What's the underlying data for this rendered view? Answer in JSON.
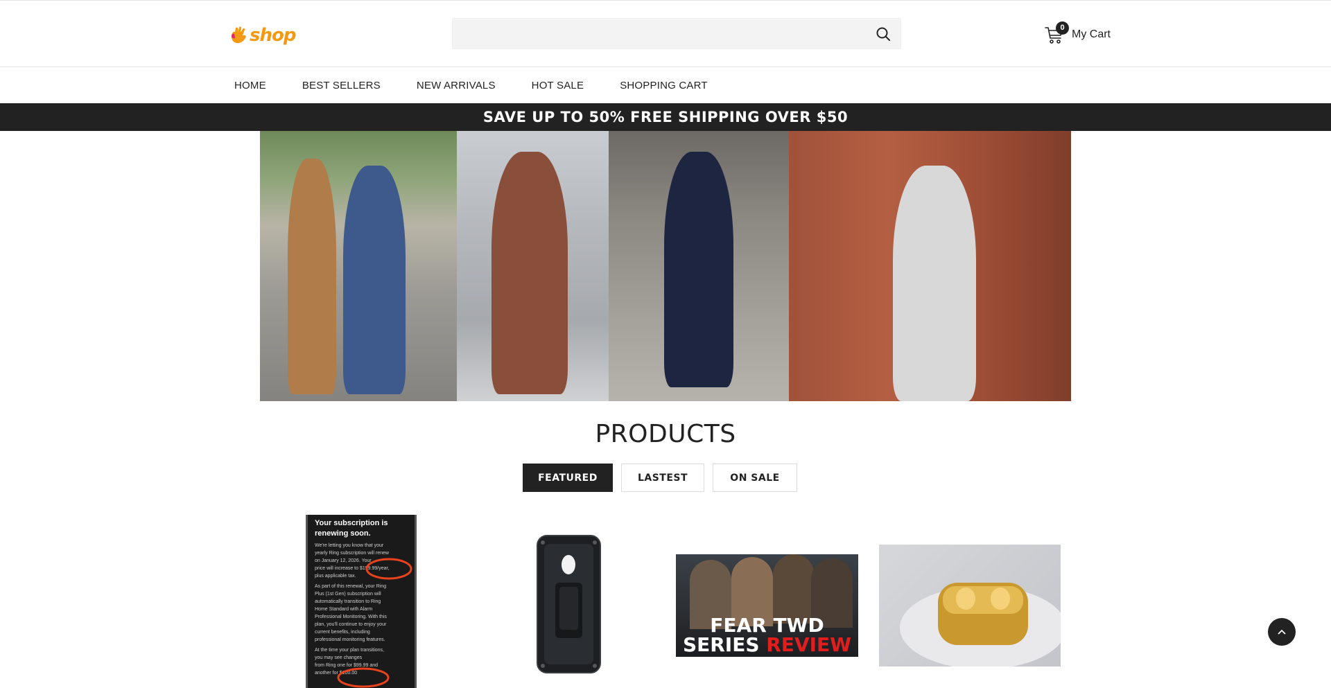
{
  "header": {
    "logo_text": "shop",
    "search_placeholder": "",
    "cart_count": "0",
    "cart_label": "My Cart"
  },
  "nav": {
    "items": [
      "HOME",
      "BEST SELLERS",
      "NEW ARRIVALS",
      "HOT SALE",
      "SHOPPING CART"
    ]
  },
  "promo": {
    "text": "SAVE UP TO 50% FREE SHIPPING OVER $50"
  },
  "products": {
    "title": "PRODUCTS",
    "tabs": [
      "FEATURED",
      "LASTEST",
      "ON SALE"
    ],
    "active_tab": "FEATURED",
    "items": [
      {
        "image_lines": [
          "Your subscription is renewing soon.",
          "We're letting you know that your",
          "yearly Ring subscription will renew",
          "on January 12, 2026. Your",
          "price will increase to $199.99/year,",
          "plus applicable tax.",
          "As part of this renewal, your Ring",
          "Plus (1st Gen) subscription will",
          "automatically transition to Ring",
          "Home Standard with Alarm",
          "Professional Monitoring. With this",
          "plan, you'll continue to enjoy your",
          "current benefits, including",
          "professional monitoring features.",
          "At the time your plan transitions,",
          "you may see changes",
          "from Ring one for $99.99 and",
          "another for $100.00"
        ]
      },
      {},
      {
        "image_title_line1": "FEAR TWD",
        "image_title_line2a": "SERIES ",
        "image_title_line2b": "REVIEW"
      },
      {}
    ]
  },
  "colors": {
    "logo_orange": "#f39a12",
    "logo_pink": "#e3217b",
    "dark": "#222222",
    "review_red": "#e11d1d"
  }
}
